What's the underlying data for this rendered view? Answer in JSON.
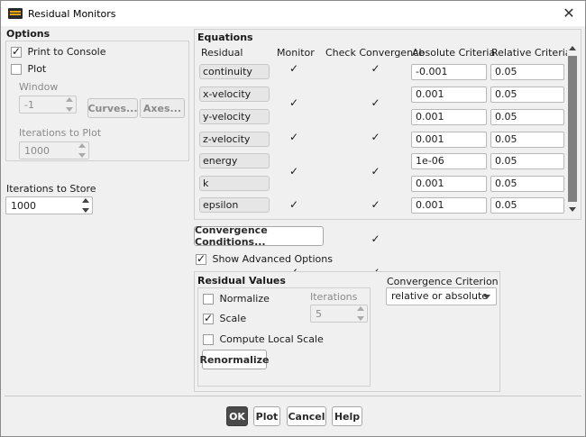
{
  "window": {
    "title": "Residual Monitors"
  },
  "options": {
    "title": "Options",
    "print_to_console": {
      "label": "Print to Console",
      "checked": true
    },
    "plot": {
      "label": "Plot",
      "checked": false
    },
    "window_label": "Window",
    "window_value": "-1",
    "curves_button": "Curves...",
    "axes_button": "Axes...",
    "iterations_to_plot_label": "Iterations to Plot",
    "iterations_to_plot_value": "1000"
  },
  "iterations_to_store": {
    "label": "Iterations to Store",
    "value": "1000"
  },
  "equations": {
    "title": "Equations",
    "headers": {
      "residual": "Residual",
      "monitor": "Monitor",
      "check_convergence": "Check Convergence",
      "absolute_criteria": "Absolute Criteria",
      "relative_criteria": "Relative Criteria"
    },
    "rows": [
      {
        "residual": "continuity",
        "monitor": true,
        "check": true,
        "absolute": "-0.001",
        "relative": "0.05"
      },
      {
        "residual": "x-velocity",
        "monitor": true,
        "check": true,
        "absolute": "0.001",
        "relative": "0.05"
      },
      {
        "residual": "y-velocity",
        "monitor": true,
        "check": true,
        "absolute": "0.001",
        "relative": "0.05"
      },
      {
        "residual": "z-velocity",
        "monitor": true,
        "check": true,
        "absolute": "0.001",
        "relative": "0.05"
      },
      {
        "residual": "energy",
        "monitor": true,
        "check": true,
        "absolute": "1e-06",
        "relative": "0.05"
      },
      {
        "residual": "k",
        "monitor": true,
        "check": true,
        "absolute": "0.001",
        "relative": "0.05"
      },
      {
        "residual": "epsilon",
        "monitor": true,
        "check": true,
        "absolute": "0.001",
        "relative": "0.05"
      }
    ]
  },
  "convergence_conditions_button": "Convergence Conditions...",
  "show_advanced_options": {
    "label": "Show Advanced Options",
    "checked": true
  },
  "residual_values": {
    "title": "Residual Values",
    "normalize": {
      "label": "Normalize",
      "checked": false
    },
    "scale": {
      "label": "Scale",
      "checked": true
    },
    "compute_local_scale": {
      "label": "Compute Local Scale",
      "checked": false
    },
    "iterations_label": "Iterations",
    "iterations_value": "5",
    "renormalize_button": "Renormalize"
  },
  "convergence_criterion": {
    "label": "Convergence Criterion",
    "value": "relative or absolute"
  },
  "footer": {
    "ok": "OK",
    "plot": "Plot",
    "cancel": "Cancel",
    "help": "Help"
  }
}
